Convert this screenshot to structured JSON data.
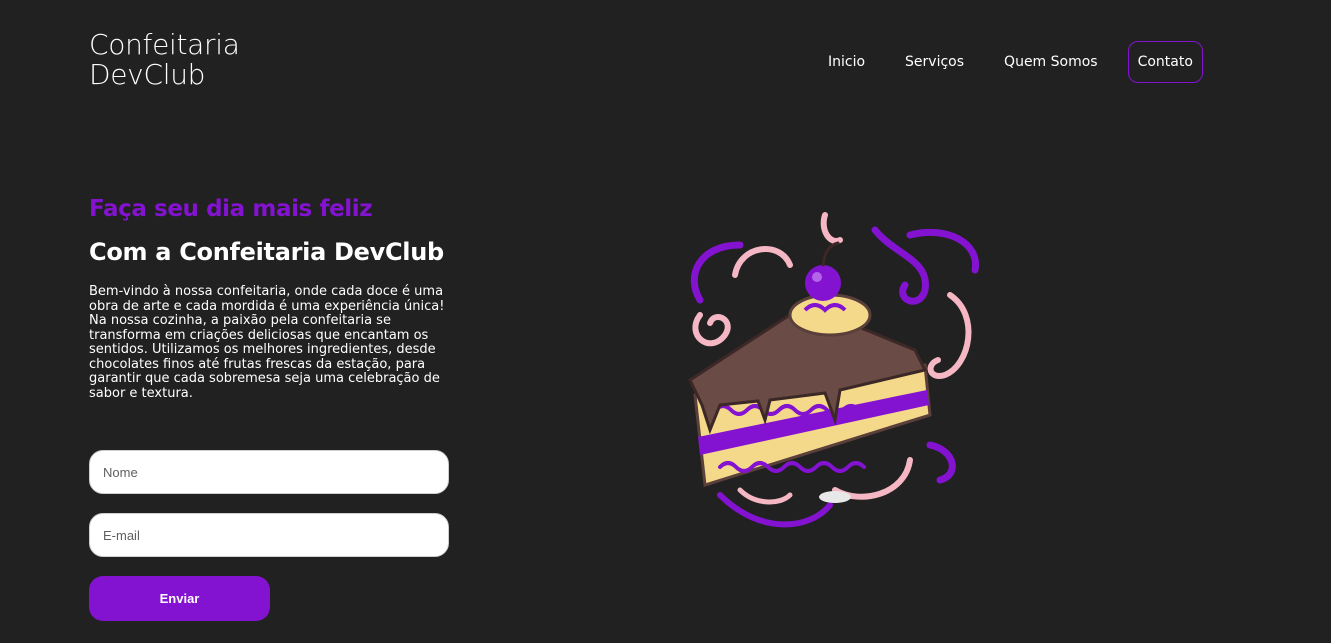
{
  "header": {
    "logo_line1": "Confeitaria",
    "logo_line2": "DevClub",
    "nav": [
      {
        "label": "Inicio"
      },
      {
        "label": "Serviços"
      },
      {
        "label": "Quem Somos"
      },
      {
        "label": "Contato"
      }
    ]
  },
  "hero": {
    "subtitle": "Faça seu dia mais feliz",
    "title": "Com a Confeitaria DevClub",
    "description": "Bem-vindo à nossa confeitaria, onde cada doce é uma obra de arte e cada mordida é uma experiência única! Na nossa cozinha, a paixão pela confeitaria se transforma em criações deliciosas que encantam os sentidos. Utilizamos os melhores ingredientes, desde chocolates finos até frutas frescas da estação, para garantir que cada sobremesa seja uma celebração de sabor e textura."
  },
  "form": {
    "name_placeholder": "Nome",
    "email_placeholder": "E-mail",
    "submit_label": "Enviar"
  },
  "colors": {
    "background": "#212121",
    "accent": "#8412d1",
    "text": "#ffffff"
  },
  "illustration": "cake-slice-illustration"
}
